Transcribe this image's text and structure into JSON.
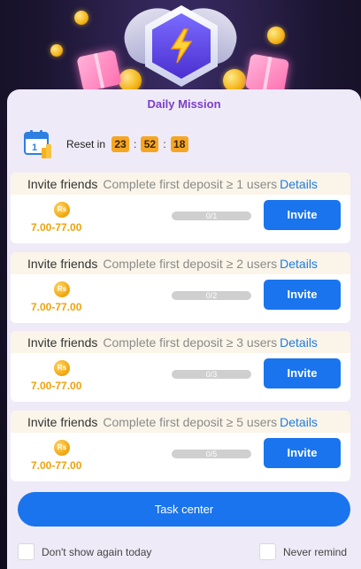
{
  "header": {
    "title": "Daily Mission"
  },
  "reset": {
    "label": "Reset in",
    "hours": "23",
    "minutes": "52",
    "seconds": "18",
    "separator": ":"
  },
  "tasks": [
    {
      "name": "Invite friends",
      "description": "Complete first deposit ≥ 1 users",
      "details_label": "Details",
      "coin_label": "Rs",
      "reward": "7.00-77.00",
      "progress_text": "0/1",
      "progress_fraction": 0,
      "button_label": "Invite"
    },
    {
      "name": "Invite friends",
      "description": "Complete first deposit ≥ 2 users",
      "details_label": "Details",
      "coin_label": "Rs",
      "reward": "7.00-77.00",
      "progress_text": "0/2",
      "progress_fraction": 0,
      "button_label": "Invite"
    },
    {
      "name": "Invite friends",
      "description": "Complete first deposit ≥ 3 users",
      "details_label": "Details",
      "coin_label": "Rs",
      "reward": "7.00-77.00",
      "progress_text": "0/3",
      "progress_fraction": 0,
      "button_label": "Invite"
    },
    {
      "name": "Invite friends",
      "description": "Complete first deposit ≥ 5 users",
      "details_label": "Details",
      "coin_label": "Rs",
      "reward": "7.00-77.00",
      "progress_text": "0/5",
      "progress_fraction": 0,
      "button_label": "Invite"
    }
  ],
  "footer": {
    "task_center_label": "Task center",
    "dont_show_label": "Don't show again today",
    "never_remind_label": "Never remind"
  },
  "colors": {
    "accent": "#1a74ee",
    "title": "#7b3fc9",
    "reward": "#f0a20a",
    "timer": "#f5a623"
  },
  "icons": [
    "lightning-icon",
    "calendar-icon",
    "rupee-coin-icon"
  ]
}
